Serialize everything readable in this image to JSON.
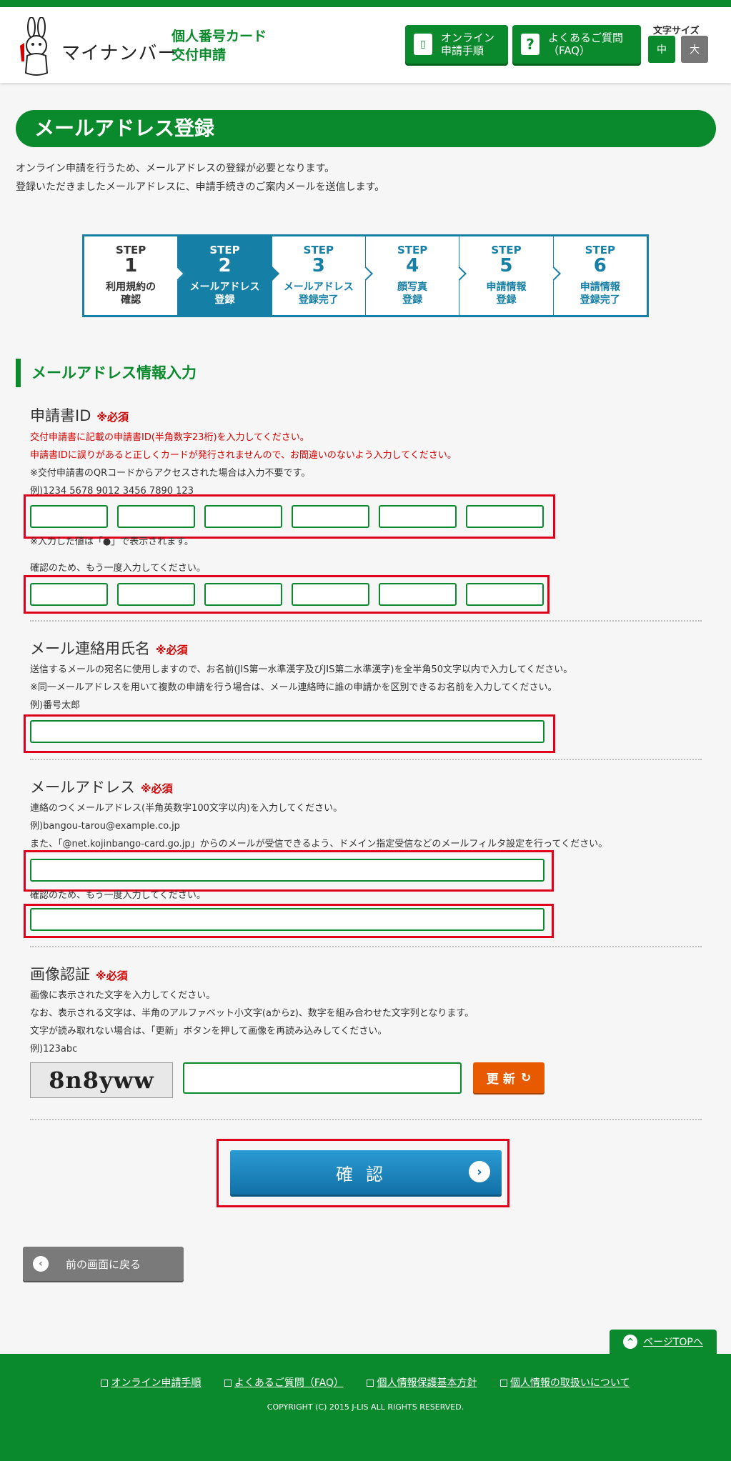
{
  "header": {
    "logo_text": "マイナンバー",
    "subtitle_line1": "個人番号カード",
    "subtitle_line2": "交付申請",
    "btn_online_line1": "オンライン",
    "btn_online_line2": "申請手順",
    "btn_faq_line1": "よくあるご質問",
    "btn_faq_line2": "（FAQ）",
    "font_size_label": "文字サイズ",
    "font_medium": "中",
    "font_large": "大"
  },
  "page": {
    "title": "メールアドレス登録",
    "intro1": "オンライン申請を行うため、メールアドレスの登録が必要となります。",
    "intro2": "登録いただきましたメールアドレスに、申請手続きのご案内メールを送信します。"
  },
  "steps": [
    {
      "st": "STEP",
      "num": "1",
      "l1": "利用規約の",
      "l2": "確認"
    },
    {
      "st": "STEP",
      "num": "2",
      "l1": "メールアドレス",
      "l2": "登録"
    },
    {
      "st": "STEP",
      "num": "3",
      "l1": "メールアドレス",
      "l2": "登録完了"
    },
    {
      "st": "STEP",
      "num": "4",
      "l1": "顔写真",
      "l2": "登録"
    },
    {
      "st": "STEP",
      "num": "5",
      "l1": "申請情報",
      "l2": "登録"
    },
    {
      "st": "STEP",
      "num": "6",
      "l1": "申請情報",
      "l2": "登録完了"
    }
  ],
  "section": {
    "title": "メールアドレス情報入力"
  },
  "app_id": {
    "title": "申請書ID",
    "required": "※必須",
    "note1": "交付申請書に記載の申請書ID(半角数字23桁)を入力してください。",
    "note2": "申請書IDに誤りがあると正しくカードが発行されませんので、お間違いのないよう入力してください。",
    "note3": "※交付申請書のQRコードからアクセスされた場合は入力不要です。",
    "example": "例)1234 5678 9012 3456 7890 123",
    "mask_note": "※入力した値は「●」で表示されます。",
    "confirm_note": "確認のため、もう一度入力してください。"
  },
  "name": {
    "title": "メール連絡用氏名",
    "required": "※必須",
    "note1": "送信するメールの宛名に使用しますので、お名前(JIS第一水準漢字及びJIS第二水準漢字)を全半角50文字以内で入力してください。",
    "note2": "※同一メールアドレスを用いて複数の申請を行う場合は、メール連絡時に誰の申請かを区別できるお名前を入力してください。",
    "example": "例)番号太郎"
  },
  "email": {
    "title": "メールアドレス",
    "required": "※必須",
    "note1": "連絡のつくメールアドレス(半角英数字100文字以内)を入力してください。",
    "example": "例)bangou-tarou@example.co.jp",
    "note2": "また、「@net.kojinbango-card.go.jp」からのメールが受信できるよう、ドメイン指定受信などのメールフィルタ設定を行ってください。",
    "confirm_note": "確認のため、もう一度入力してください。"
  },
  "captcha": {
    "title": "画像認証",
    "required": "※必須",
    "note1": "画像に表示された文字を入力してください。",
    "note2": "なお、表示される文字は、半角のアルファベット小文字(aからz)、数字を組み合わせた文字列となります。",
    "note3": "文字が読み取れない場合は、「更新」ボタンを押して画像を再読み込みしてください。",
    "example": "例)123abc",
    "image_text": "8n8yww",
    "refresh": "更 新"
  },
  "actions": {
    "confirm": "確認",
    "back": "前の画面に戻る",
    "page_top": "ページTOPへ"
  },
  "footer": {
    "link1": "オンライン申請手順",
    "link2": "よくあるご質問（FAQ）",
    "link3": "個人情報保護基本方針",
    "link4": "個人情報の取扱いについて",
    "copyright": "COPYRIGHT (C) 2015 J-LIS ALL RIGHTS RESERVED."
  },
  "colors": {
    "brand_green": "#0a8a2c",
    "step_blue": "#157fa5",
    "required_red": "#d40000",
    "highlight_red": "#e0001b",
    "refresh_orange": "#e85a00"
  }
}
